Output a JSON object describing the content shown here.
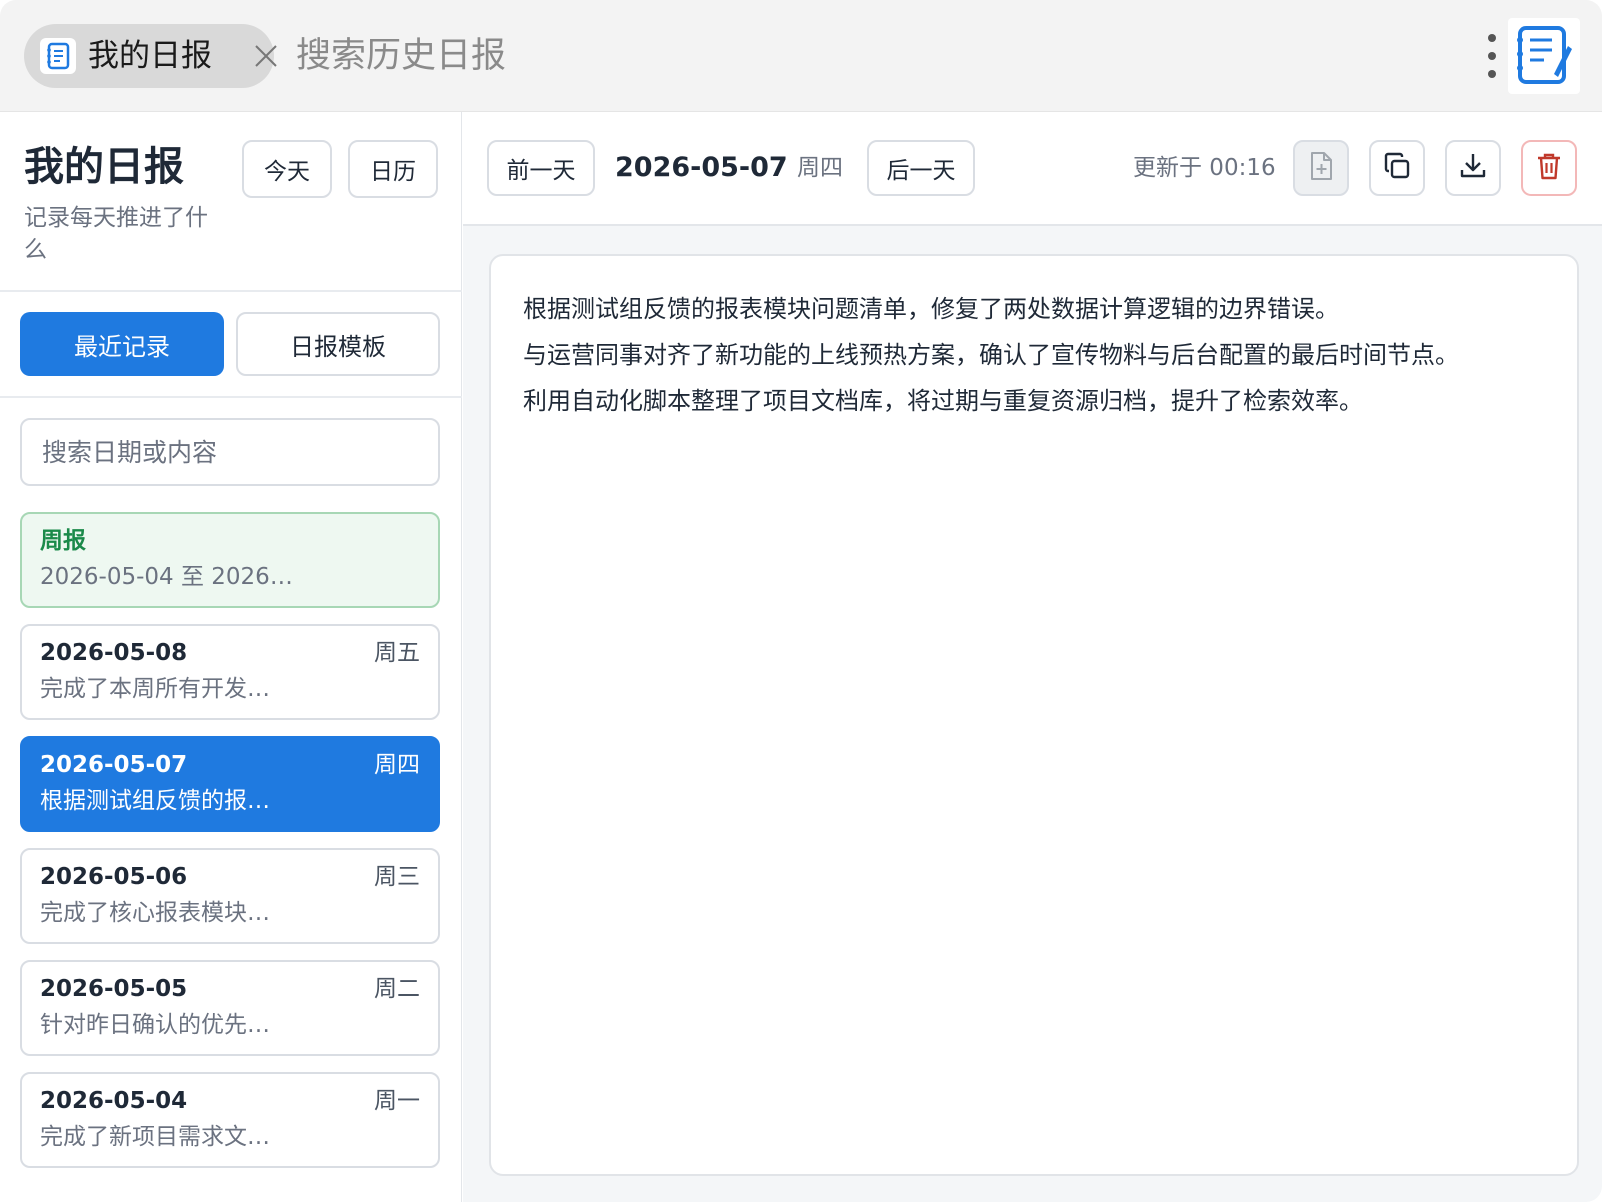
{
  "topbar": {
    "tab_title": "我的日报",
    "search_placeholder": "搜索历史日报"
  },
  "sidebar": {
    "title": "我的日报",
    "subtitle": "记录每天推进了什么",
    "today_label": "今天",
    "calendar_label": "日历",
    "segments": {
      "recent": "最近记录",
      "template": "日报模板"
    },
    "search_placeholder": "搜索日期或内容",
    "entries": [
      {
        "date": "周报",
        "weekday": "",
        "snippet": "2026-05-04 至 2026…",
        "kind": "weekly"
      },
      {
        "date": "2026-05-08",
        "weekday": "周五",
        "snippet": "完成了本周所有开发…",
        "kind": "normal"
      },
      {
        "date": "2026-05-07",
        "weekday": "周四",
        "snippet": "根据测试组反馈的报…",
        "kind": "active"
      },
      {
        "date": "2026-05-06",
        "weekday": "周三",
        "snippet": "完成了核心报表模块…",
        "kind": "normal"
      },
      {
        "date": "2026-05-05",
        "weekday": "周二",
        "snippet": "针对昨日确认的优先…",
        "kind": "normal"
      },
      {
        "date": "2026-05-04",
        "weekday": "周一",
        "snippet": "完成了新项目需求文…",
        "kind": "normal"
      }
    ]
  },
  "main": {
    "prev_label": "前一天",
    "next_label": "后一天",
    "date": "2026-05-07",
    "weekday": "周四",
    "updated": "更新于 00:16",
    "content_lines": [
      "根据测试组反馈的报表模块问题清单，修复了两处数据计算逻辑的边界错误。",
      "与运营同事对齐了新功能的上线预热方案，确认了宣传物料与后台配置的最后时间节点。",
      "利用自动化脚本整理了项目文档库，将过期与重复资源归档，提升了检索效率。"
    ]
  },
  "colors": {
    "accent": "#1f7ae0",
    "weekly_bg": "#eef8f1",
    "weekly_text": "#1b8a4a",
    "danger": "#c0392b"
  },
  "icons": {
    "tab": "notebook-icon",
    "close": "close-icon",
    "menu": "kebab-menu-icon",
    "logo": "notebook-pen-icon",
    "new_file": "file-plus-icon",
    "copy": "copy-icon",
    "download": "download-icon",
    "delete": "trash-icon"
  }
}
